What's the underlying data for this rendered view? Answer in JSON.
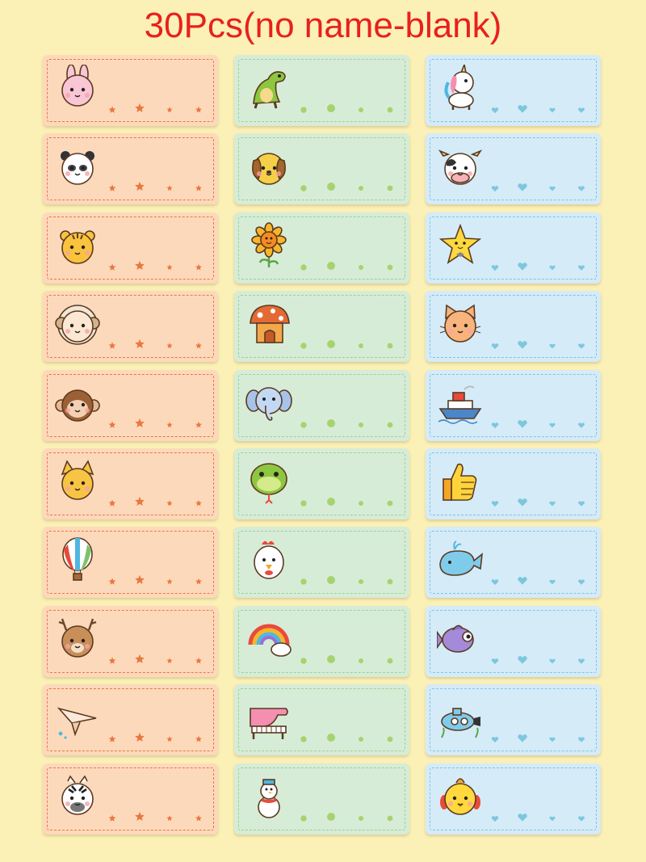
{
  "title": "30Pcs(no name-blank)",
  "colors": {
    "background": "#fbf0b6",
    "title": "#e8201c",
    "orange_fill": "#fdd9bb",
    "orange_accent": "#e9783f",
    "green_fill": "#d7ecd6",
    "green_accent": "#9dcf9b",
    "blue_fill": "#d5ebf8",
    "blue_accent": "#7cc7de"
  },
  "columns": [
    {
      "theme": "orange",
      "decoration": "stars",
      "icons": [
        "rabbit-icon",
        "panda-icon",
        "tiger-icon",
        "sheep-icon",
        "monkey-icon",
        "squirrel-icon",
        "hot-air-balloon-icon",
        "deer-icon",
        "paper-plane-icon",
        "zebra-icon"
      ]
    },
    {
      "theme": "green",
      "decoration": "dots",
      "icons": [
        "dinosaur-icon",
        "puppy-icon",
        "sunflower-icon",
        "mushroom-house-icon",
        "elephant-icon",
        "snake-icon",
        "chicken-icon",
        "rainbow-icon",
        "piano-icon",
        "snowman-icon"
      ]
    },
    {
      "theme": "blue",
      "decoration": "hearts",
      "icons": [
        "unicorn-icon",
        "cow-icon",
        "star-icon",
        "cat-icon",
        "ship-icon",
        "thumbs-up-icon",
        "whale-icon",
        "fish-icon",
        "submarine-icon",
        "chick-icon"
      ]
    }
  ]
}
